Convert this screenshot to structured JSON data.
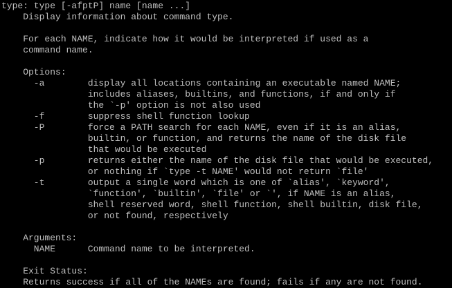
{
  "terminal": {
    "fg_color": "#c0c0c0",
    "bg_color": "#000000",
    "lines": [
      "type: type [-afptP] name [name ...]",
      "    Display information about command type.",
      "",
      "    For each NAME, indicate how it would be interpreted if used as a",
      "    command name.",
      "",
      "    Options:",
      "      -a        display all locations containing an executable named NAME;",
      "                includes aliases, builtins, and functions, if and only if",
      "                the `-p' option is not also used",
      "      -f        suppress shell function lookup",
      "      -P        force a PATH search for each NAME, even if it is an alias,",
      "                builtin, or function, and returns the name of the disk file",
      "                that would be executed",
      "      -p        returns either the name of the disk file that would be executed,",
      "                or nothing if `type -t NAME' would not return `file'",
      "      -t        output a single word which is one of `alias', `keyword',",
      "                `function', `builtin', `file' or `', if NAME is an alias,",
      "                shell reserved word, shell function, shell builtin, disk file,",
      "                or not found, respectively",
      "",
      "    Arguments:",
      "      NAME      Command name to be interpreted.",
      "",
      "    Exit Status:",
      "    Returns success if all of the NAMEs are found; fails if any are not found."
    ]
  }
}
